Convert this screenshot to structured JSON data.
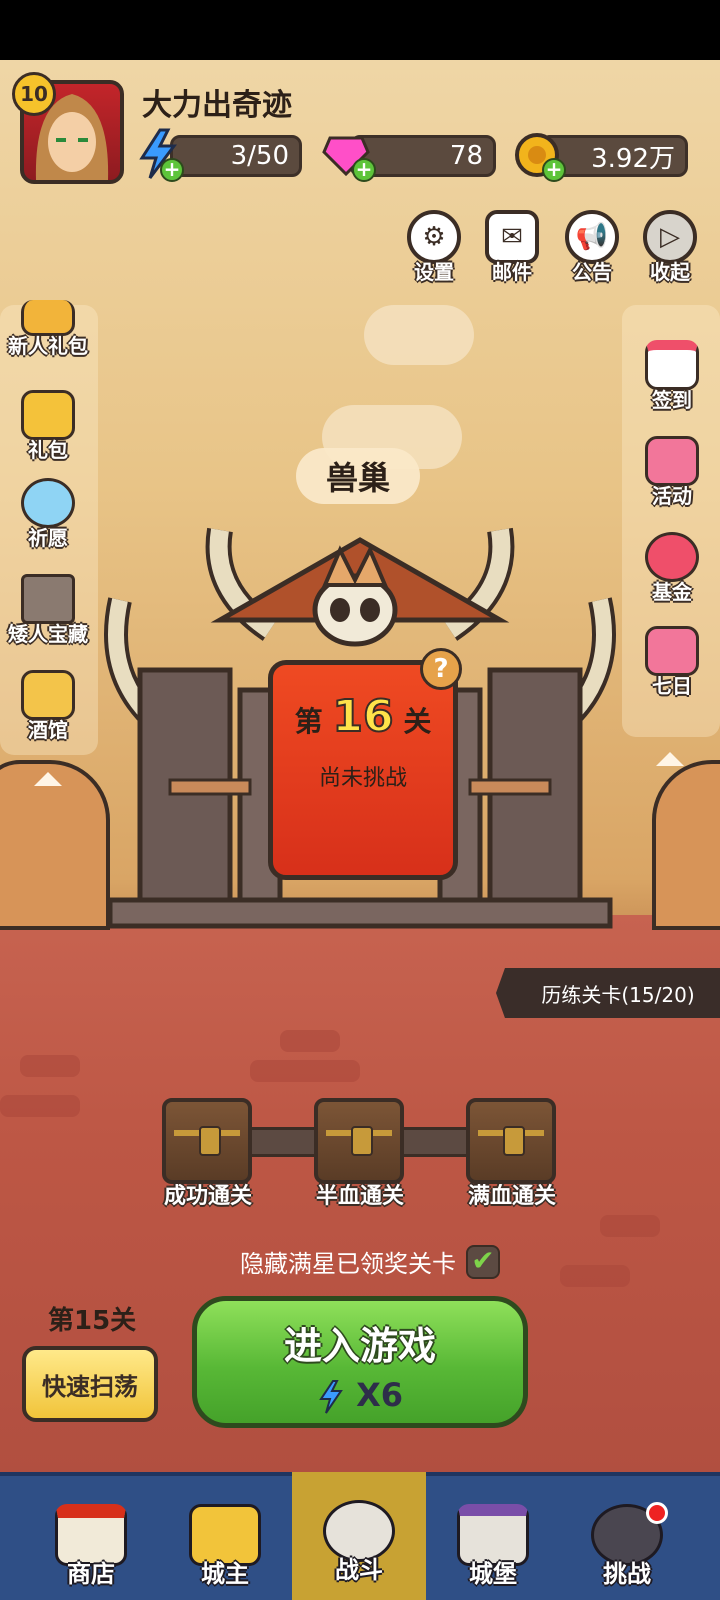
{
  "player": {
    "name": "大力出奇迹",
    "level": "10"
  },
  "resources": [
    {
      "id": "energy",
      "icon": "lightning-icon",
      "value": "3/50",
      "color": "#3a9bff"
    },
    {
      "id": "gems",
      "icon": "gem-icon",
      "value": "78",
      "color": "#ff4fc8"
    },
    {
      "id": "gold",
      "icon": "gold-coin-icon",
      "value": "3.92万",
      "color": "#f2b41c"
    }
  ],
  "top_buttons": [
    {
      "label": "设置",
      "icon": "gear-icon"
    },
    {
      "label": "邮件",
      "icon": "mail-icon"
    },
    {
      "label": "公告",
      "icon": "megaphone-icon"
    },
    {
      "label": "收起",
      "icon": "collapse-icon"
    }
  ],
  "left_menu": [
    {
      "label": "新人礼包",
      "icon": "newbie-gift-icon"
    },
    {
      "label": "礼包",
      "icon": "gift-box-icon"
    },
    {
      "label": "祈愿",
      "icon": "wish-star-icon"
    },
    {
      "label": "矮人宝藏",
      "icon": "pickaxe-icon"
    },
    {
      "label": "酒馆",
      "icon": "beer-mug-icon"
    }
  ],
  "right_menu": [
    {
      "label": "签到",
      "icon": "calendar-icon"
    },
    {
      "label": "活动",
      "icon": "event-stars-icon"
    },
    {
      "label": "基金",
      "icon": "money-bag-icon"
    },
    {
      "label": "七日",
      "icon": "seven-day-gift-icon"
    }
  ],
  "stage": {
    "name": "兽巢",
    "level_prefix": "第",
    "level_number": "16",
    "level_suffix": "关",
    "status": "尚未挑战",
    "help": "?"
  },
  "training": {
    "label": "历练关卡(15/20)"
  },
  "chests": [
    {
      "label": "成功通关"
    },
    {
      "label": "半血通关"
    },
    {
      "label": "满血通关"
    }
  ],
  "hide_option": {
    "label": "隐藏满星已领奖关卡",
    "checked": true
  },
  "sweep": {
    "level_label": "第15关",
    "button_label": "快速扫荡"
  },
  "enter_game": {
    "label": "进入游戏",
    "cost": "X6"
  },
  "bottom_nav": [
    {
      "label": "商店",
      "icon": "shop-icon",
      "active": false
    },
    {
      "label": "城主",
      "icon": "crown-icon",
      "active": false
    },
    {
      "label": "战斗",
      "icon": "crossed-swords-icon",
      "active": true
    },
    {
      "label": "城堡",
      "icon": "castle-icon",
      "active": false
    },
    {
      "label": "挑战",
      "icon": "demon-helmet-icon",
      "active": false
    }
  ]
}
